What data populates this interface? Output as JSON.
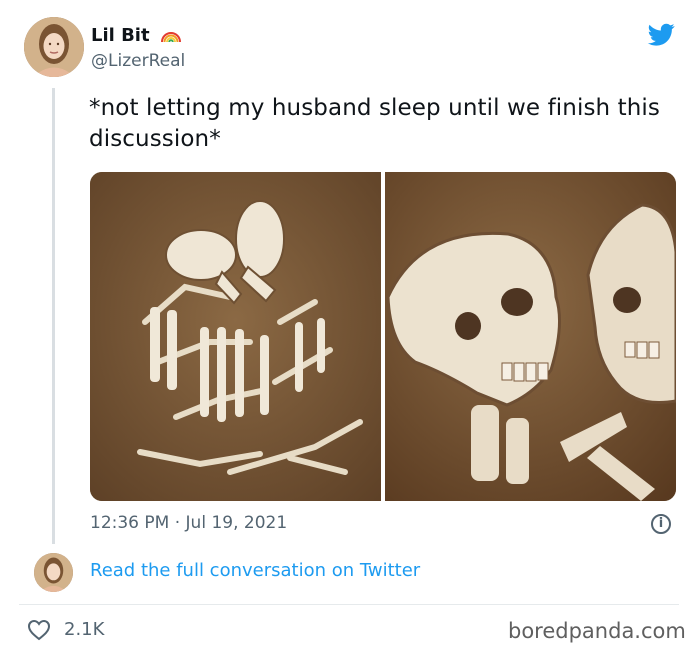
{
  "tweet": {
    "display_name": "Lil Bit",
    "handle": "@LizerReal",
    "text": "*not letting my husband sleep until we finish this discussion*",
    "timestamp": "12:36 PM · Jul 19, 2021",
    "read_more": "Read the full conversation on Twitter",
    "likes": "2.1K"
  },
  "icons": {
    "name_emoji": "rainbow-icon",
    "brand": "twitter-bird-icon",
    "info": "info-icon",
    "like": "heart-icon"
  },
  "watermark": "boredpanda.com",
  "colors": {
    "link": "#1d9bf0",
    "brand": "#1d9bf0",
    "secondary": "#536471",
    "soil": "#7a5a38"
  }
}
